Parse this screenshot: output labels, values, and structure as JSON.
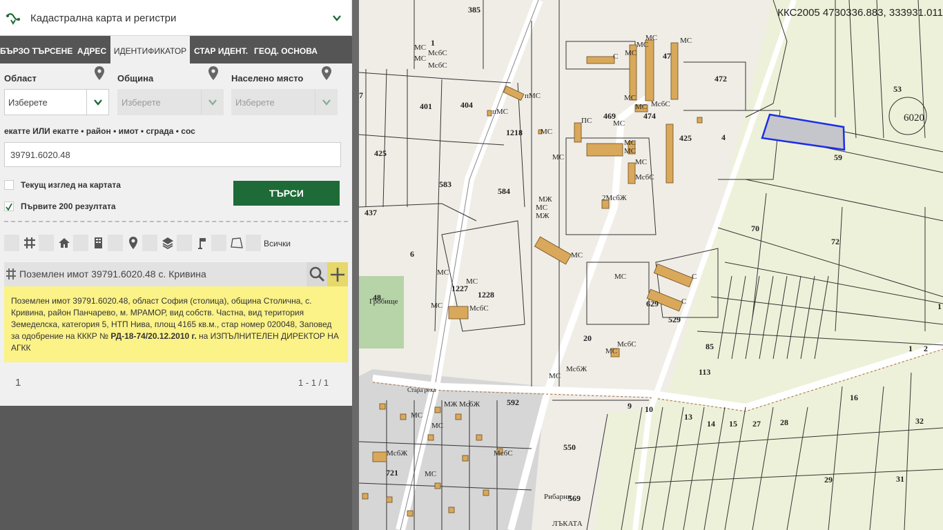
{
  "app": {
    "title": "Кадастрална карта и регистри"
  },
  "tabs": [
    {
      "label": "БЪРЗО ТЪРСЕНЕ",
      "active": false
    },
    {
      "label": "АДРЕС",
      "active": false
    },
    {
      "label": "ИДЕНТИФИКАТОР",
      "active": true
    },
    {
      "label": "СТАР ИДЕНТ.",
      "active": false
    },
    {
      "label": "ГЕОД. ОСНОВА",
      "active": false
    }
  ],
  "filters": {
    "oblast": {
      "label": "Област",
      "placeholder": "Изберете"
    },
    "obshtina": {
      "label": "Община",
      "placeholder": "Изберете"
    },
    "naseleno": {
      "label": "Населено място",
      "placeholder": "Изберете"
    }
  },
  "identifier": {
    "hint": "екатте ИЛИ екатте • район • имот • сграда • сос",
    "value": "39791.6020.48"
  },
  "options": {
    "current_view": {
      "label": "Текущ изглед на картата",
      "checked": false
    },
    "first200": {
      "label": "Първите 200 резултата",
      "checked": true
    }
  },
  "search_button": "ТЪРСИ",
  "feature_types": {
    "icons": [
      "grid-icon",
      "house-icon",
      "building-icon",
      "location-pin-icon",
      "layers-icon",
      "flag-icon",
      "polygon-icon"
    ],
    "all_label": "Всички"
  },
  "result": {
    "title": "Поземлен имот 39791.6020.48 с. Кривина",
    "desc_1": "Поземлен имот 39791.6020.48, област София (столица), община Столична, с. Кривина, район Панчарево, м. МРАМОР, вид собств. Частна, вид територия Земеделска, категория 5, НТП Нива, площ 4165 кв.м., стар номер 020048, Заповед за одобрение на КККР №",
    "desc_order": "РД-18-74/20.12.2010 г.",
    "desc_2": "на ИЗПЪЛНИТЕЛЕН ДИРЕКТОР НА АГКК"
  },
  "pagination": {
    "page": "1",
    "count": "1 - 1 / 1"
  },
  "map": {
    "coords": "ККС2005 4730336.883, 333931.011",
    "highlight_color": "#1b2ee8",
    "parcel_labels": [
      "385",
      "1",
      "47",
      "472",
      "53",
      "6020",
      "7",
      "401",
      "404",
      "1218",
      "469",
      "474",
      "425",
      "4",
      "59",
      "425",
      "583",
      "584",
      "437",
      "70",
      "72",
      "6",
      "1227",
      "1228",
      "629",
      "48",
      "529",
      "20",
      "85",
      "113",
      "1",
      "2",
      "1",
      "9",
      "10",
      "13",
      "14",
      "15",
      "27",
      "28",
      "16",
      "32",
      "592",
      "550",
      "721",
      "29",
      "31",
      "569"
    ],
    "building_labels": [
      "МС",
      "МсбС",
      "МС",
      "МсбС",
      "МС",
      "МС",
      "МС",
      "С",
      "МС",
      "пМС",
      "пМС",
      "МС",
      "ПС",
      "МС",
      "МС",
      "МсбС",
      "МС",
      "МС",
      "МС",
      "МС",
      "МС",
      "МсбС",
      "МЖ",
      "МС",
      "МЖ",
      "2МсбЖ",
      "МС",
      "МС",
      "МС",
      "МС",
      "МсбС",
      "МС",
      "МС",
      "С",
      "С",
      "МсбС",
      "МС",
      "МсбЖ",
      "МС",
      "МС",
      "МЖ",
      "МсбЖ",
      "МсбЖ",
      "МС",
      "МсбС"
    ],
    "place_labels": [
      "Гробище",
      "Стара река",
      "Рибарни",
      "ЛЪКАТА"
    ]
  }
}
